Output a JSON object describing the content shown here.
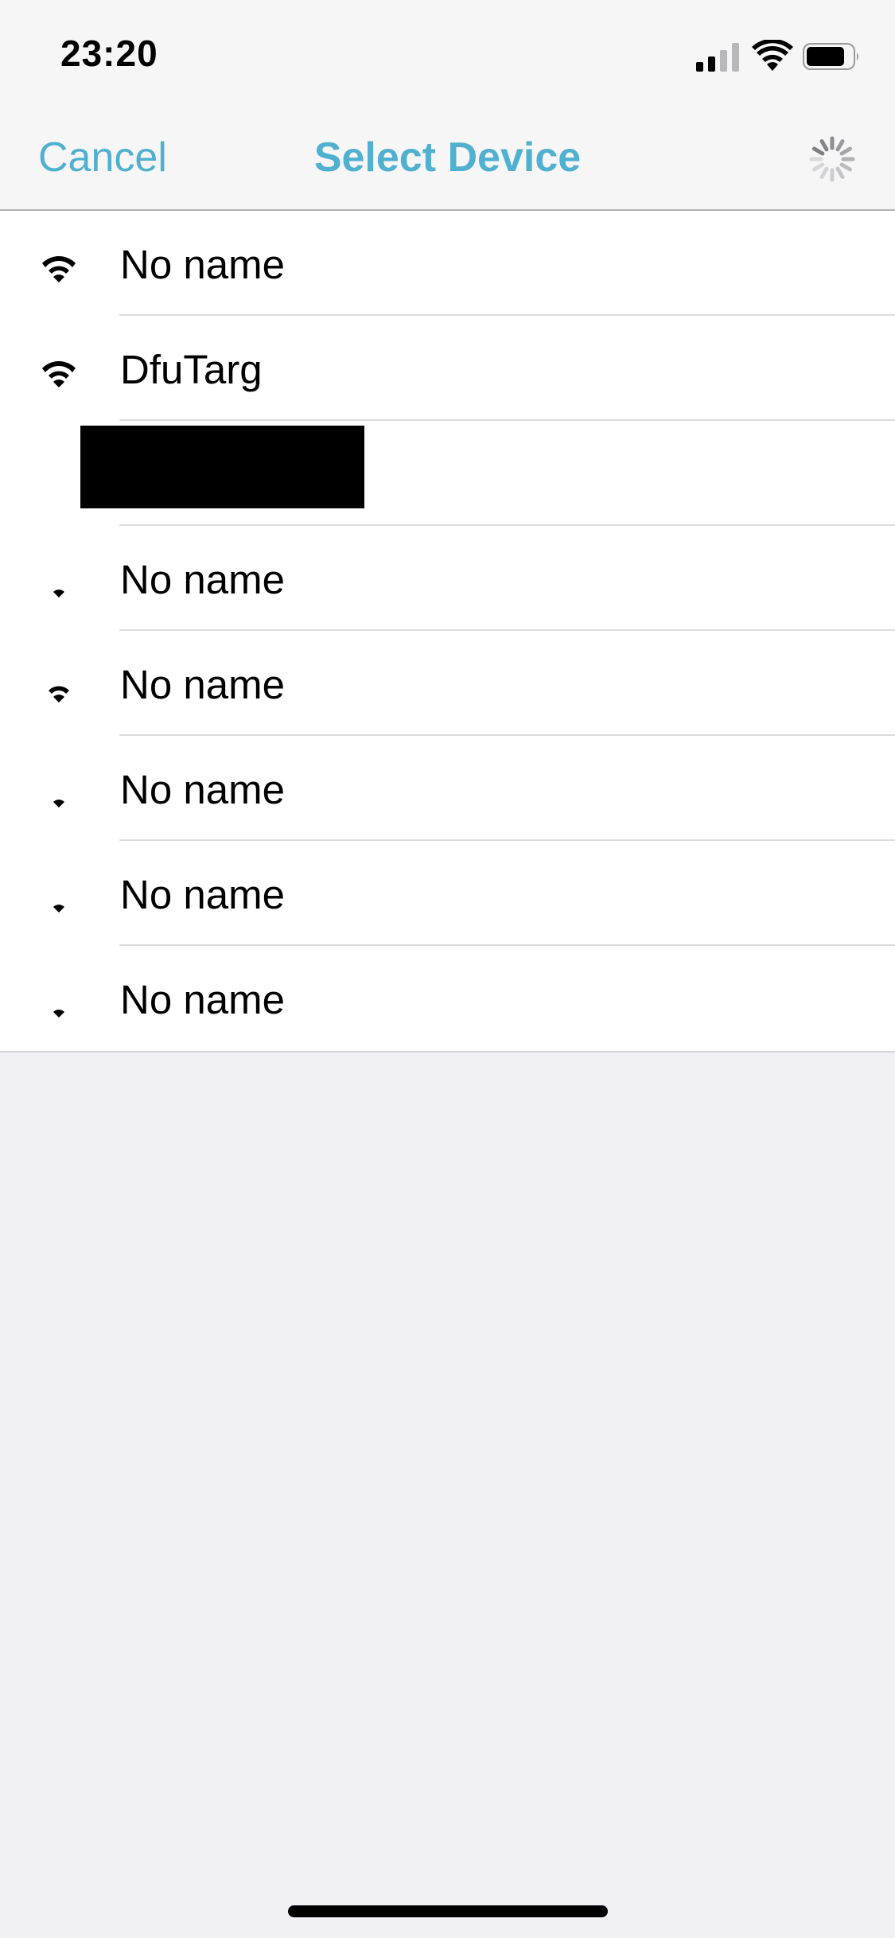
{
  "status_bar": {
    "time": "23:20",
    "icons": [
      "cellular-signal-icon",
      "wifi-icon",
      "battery-icon"
    ],
    "signal_bars_active": 2,
    "signal_bars_total": 4,
    "battery_level": 0.8
  },
  "nav": {
    "cancel_label": "Cancel",
    "title": "Select Device",
    "activity_indicator": "loading-spinner-icon"
  },
  "devices": [
    {
      "name": "No name",
      "signal_strength": 3
    },
    {
      "name": "DfuTarg",
      "signal_strength": 3
    },
    {
      "name": "",
      "signal_strength": 0,
      "redacted": true
    },
    {
      "name": "No name",
      "signal_strength": 1
    },
    {
      "name": "No name",
      "signal_strength": 2
    },
    {
      "name": "No name",
      "signal_strength": 1
    },
    {
      "name": "No name",
      "signal_strength": 1
    },
    {
      "name": "No name",
      "signal_strength": 1
    }
  ],
  "colors": {
    "accent": "#4fb0cf",
    "list_background": "#ffffff",
    "page_background": "#f0f0f5",
    "bar_background": "#f6f6f7",
    "separator": "#dcdcdf"
  }
}
